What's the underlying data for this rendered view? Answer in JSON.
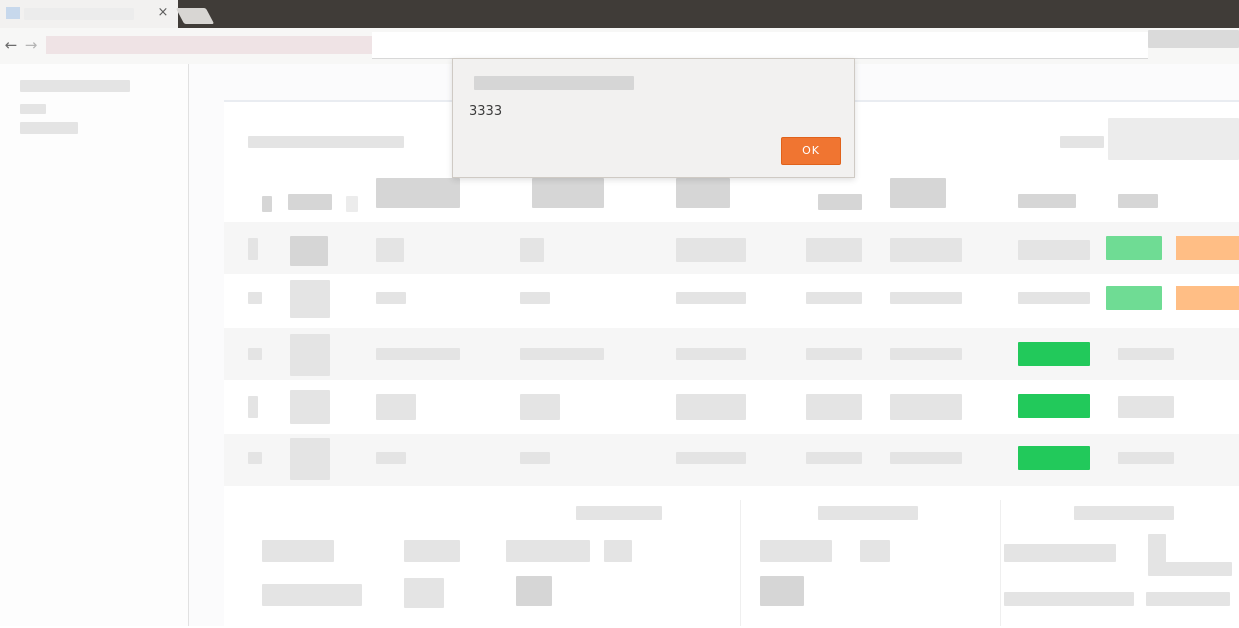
{
  "browser": {
    "tab_close_glyph": "×",
    "back_glyph": "←",
    "forward_glyph": "→"
  },
  "dialog": {
    "message": "3333",
    "ok_label": "OK",
    "ok_color": "#f07531"
  },
  "colors": {
    "action_green": "#22c95b",
    "action_green_light": "#6fdc94",
    "action_orange": "#ffbe85"
  }
}
